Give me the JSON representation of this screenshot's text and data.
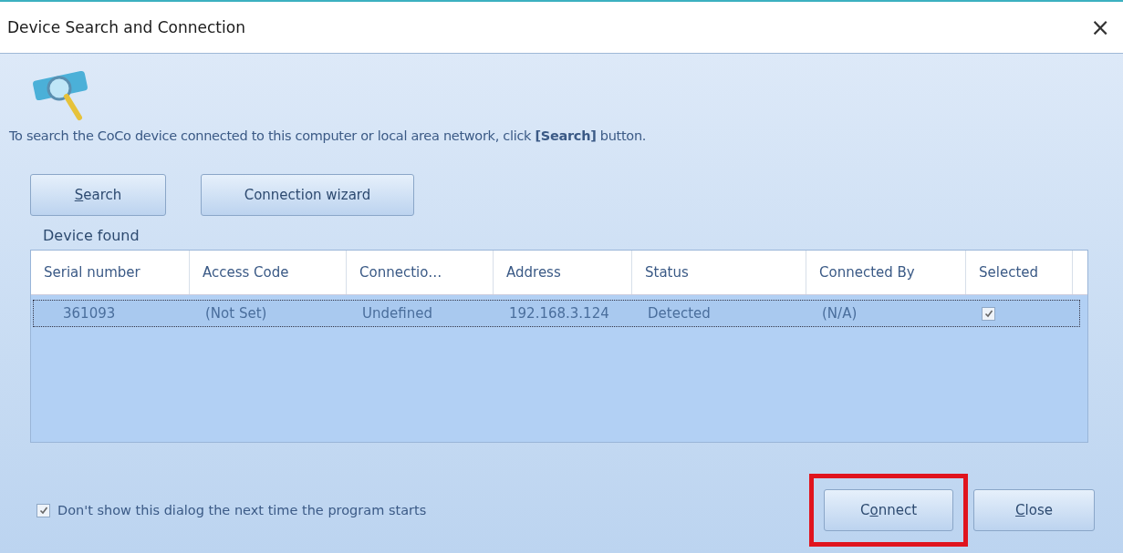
{
  "window": {
    "title": "Device Search and Connection",
    "close": "×"
  },
  "instruction": "To search the CoCo device connected to this computer or local area network, click **[Search]** button.",
  "top_buttons": [
    {
      "access_key": "S",
      "after_key": "earch"
    },
    {
      "label": "Connection wizard"
    }
  ],
  "group_label": "Device found",
  "table": {
    "columns": [
      "Serial number",
      "Access Code",
      "Connectio…",
      "Address",
      "Status",
      "Connected By",
      "Selected"
    ],
    "rows": [
      {
        "selected": true,
        "serial": "361093",
        "access_code": "(Not Set)",
        "connection": "Undefined",
        "address": "192.168.3.124",
        "status": "Detected",
        "connected_by": "(N/A)",
        "checked": true
      }
    ]
  },
  "dont_show": {
    "label": "Don't show this dialog the next time the program starts",
    "checked": true
  },
  "bottom_buttons": [
    {
      "before_key": "C",
      "access_key": "o",
      "after_key": "nnect",
      "highlighted": true
    },
    {
      "access_key": "C",
      "after_key": "lose",
      "highlighted": false
    }
  ]
}
